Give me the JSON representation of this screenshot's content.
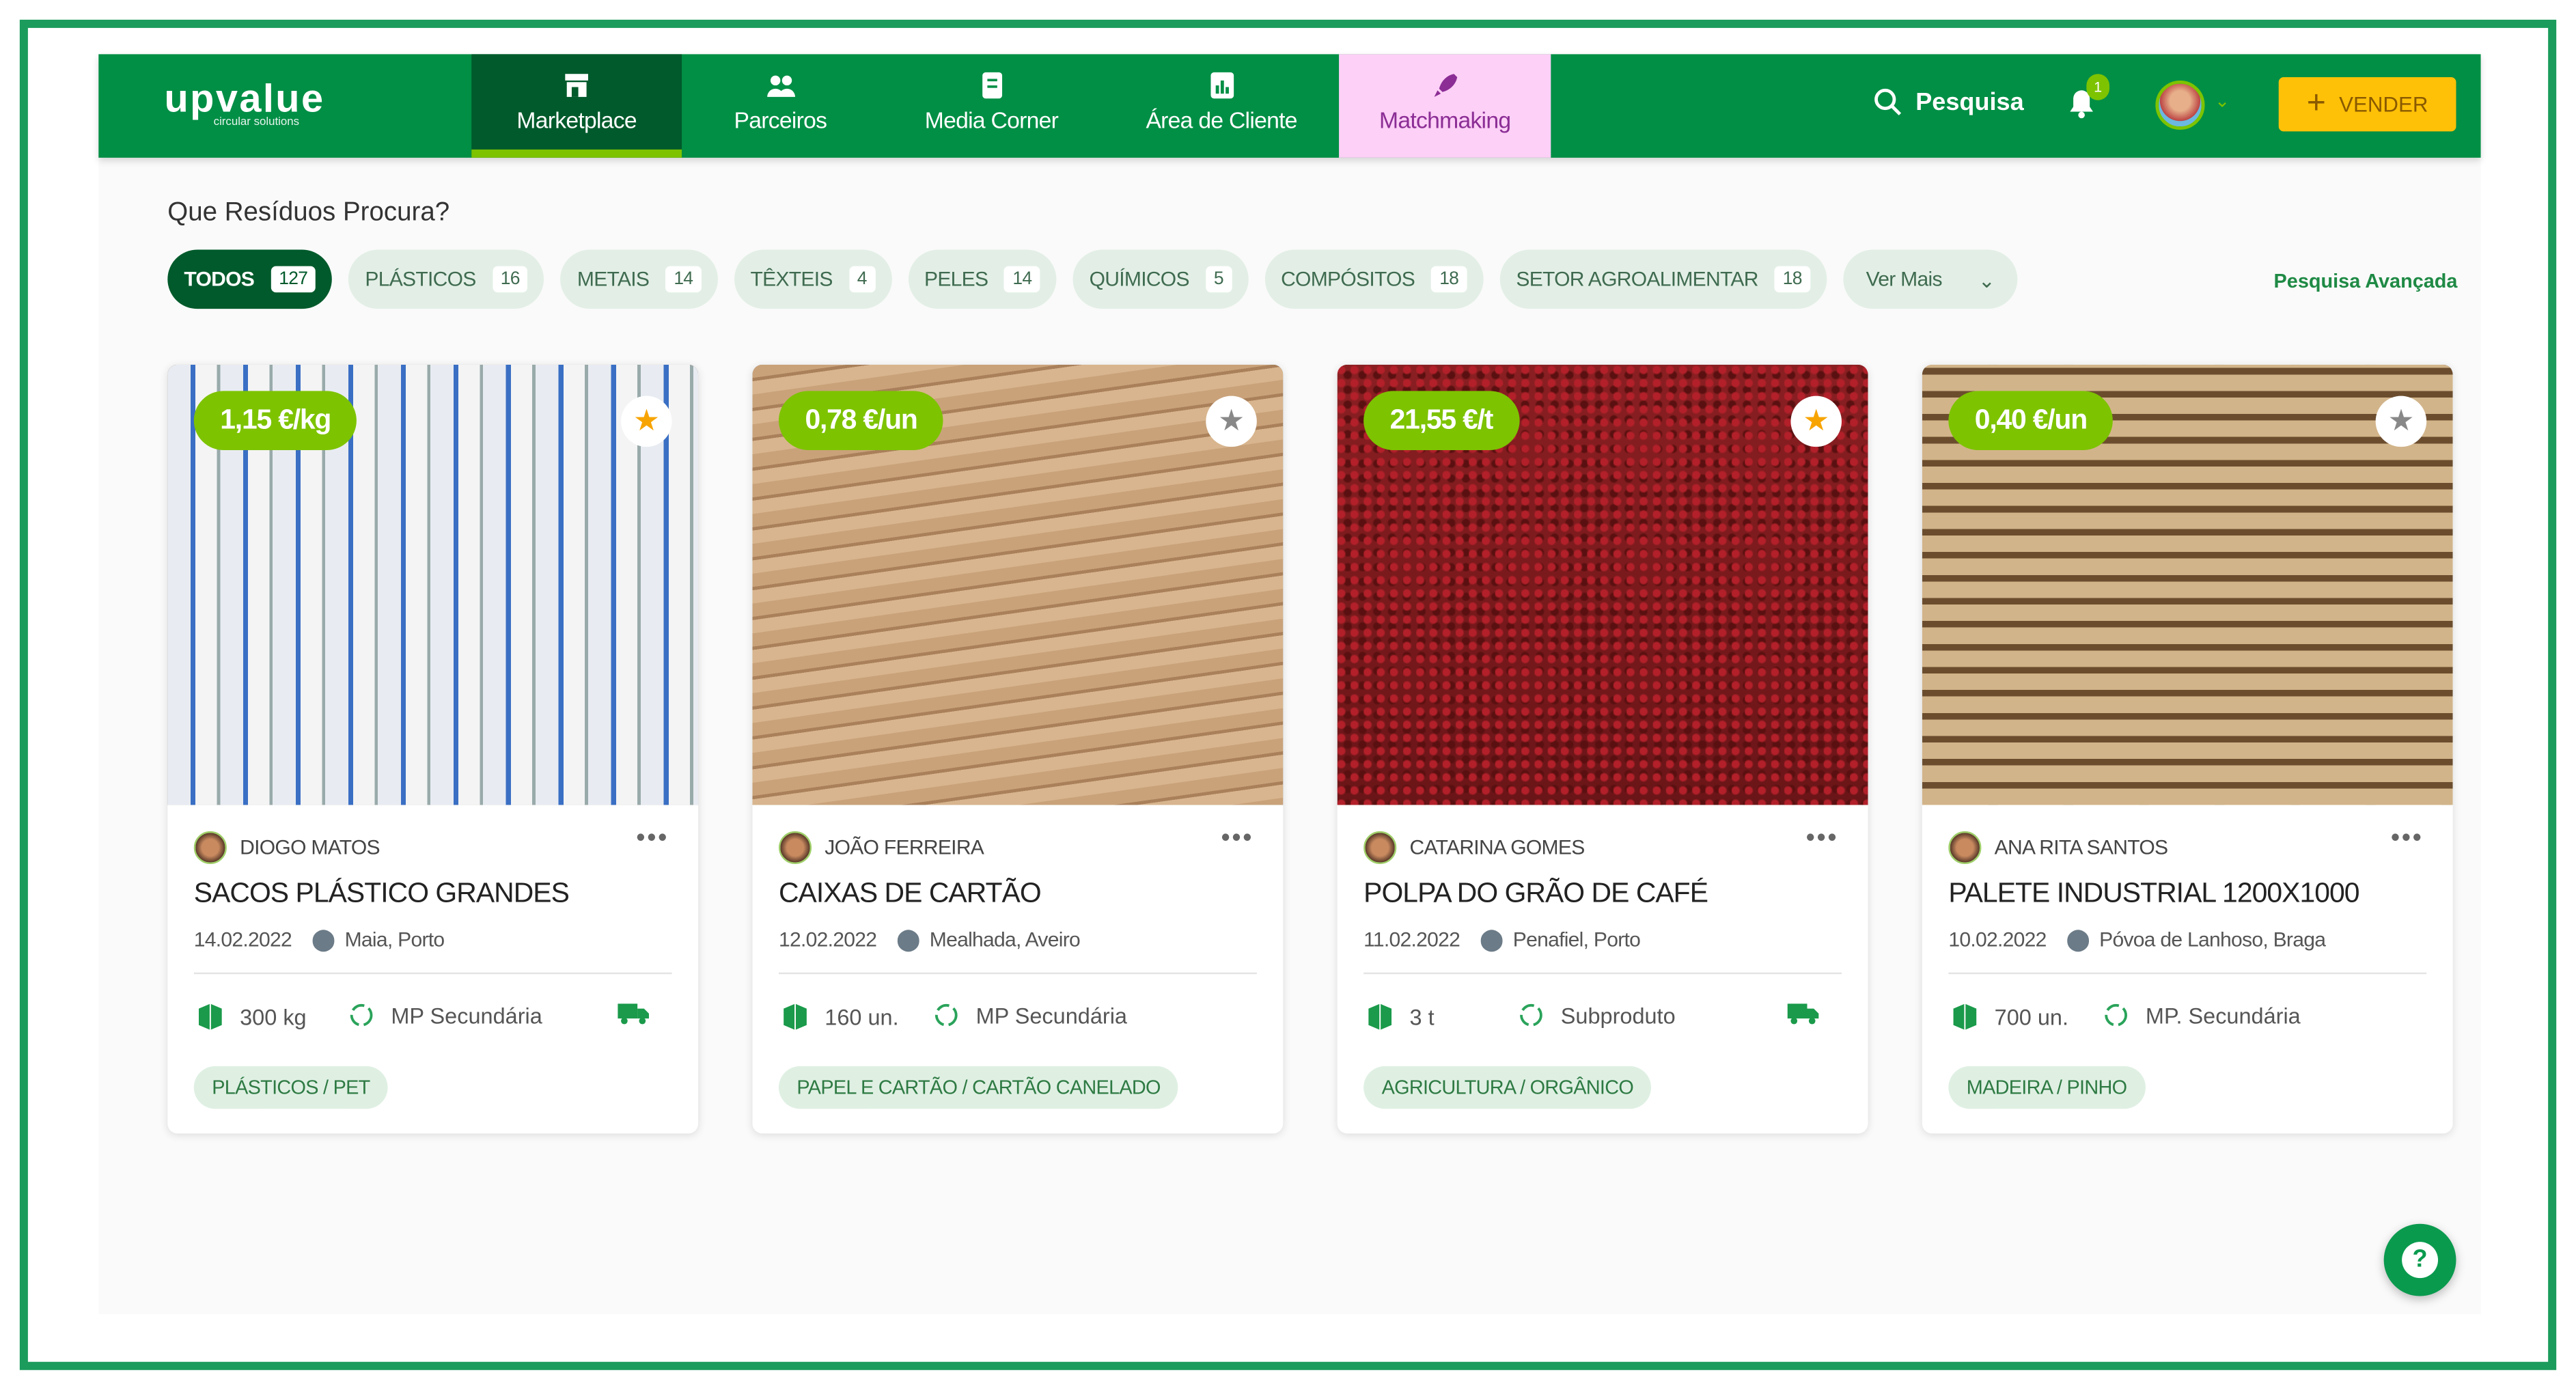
{
  "brand": {
    "name": "upvalue",
    "tagline": "circular solutions"
  },
  "nav": {
    "tabs": [
      {
        "label": "Marketplace"
      },
      {
        "label": "Parceiros"
      },
      {
        "label": "Media Corner"
      },
      {
        "label": "Área de Cliente"
      },
      {
        "label": "Matchmaking"
      }
    ],
    "search_label": "Pesquisa",
    "notifications": "1",
    "sell_label": "VENDER",
    "sell_icon": "+"
  },
  "filters": {
    "heading": "Que Resíduos Procura?",
    "chips": [
      {
        "label": "TODOS",
        "count": "127"
      },
      {
        "label": "PLÁSTICOS",
        "count": "16"
      },
      {
        "label": "METAIS",
        "count": "14"
      },
      {
        "label": "TÊXTEIS",
        "count": "4"
      },
      {
        "label": "PELES",
        "count": "14"
      },
      {
        "label": "QUÍMICOS",
        "count": "5"
      },
      {
        "label": "COMPÓSITOS",
        "count": "18"
      },
      {
        "label": "SETOR AGROALIMENTAR",
        "count": "18"
      }
    ],
    "more_label": "Ver Mais",
    "advanced_label": "Pesquisa Avançada"
  },
  "cards": [
    {
      "price": "1,15 €/kg",
      "favorite": true,
      "user": "DIOGO MATOS",
      "title": "SACOS PLÁSTICO GRANDES",
      "date": "14.02.2022",
      "location": "Maia, Porto",
      "quantity": "300 kg",
      "type": "MP Secundária",
      "transport": true,
      "tag": "PLÁSTICOS / PET"
    },
    {
      "price": "0,78 €/un",
      "favorite": false,
      "user": "JOÃO FERREIRA",
      "title": "CAIXAS DE CARTÃO",
      "date": "12.02.2022",
      "location": "Mealhada, Aveiro",
      "quantity": "160 un.",
      "type": "MP Secundária",
      "transport": false,
      "tag": "PAPEL E CARTÃO / CARTÃO CANELADO"
    },
    {
      "price": "21,55 €/t",
      "favorite": true,
      "user": "CATARINA GOMES",
      "title": "POLPA DO GRÃO DE CAFÉ",
      "date": "11.02.2022",
      "location": "Penafiel, Porto",
      "quantity": "3 t",
      "type": "Subproduto",
      "transport": true,
      "tag": "AGRICULTURA / ORGÂNICO"
    },
    {
      "price": "0,40 €/un",
      "favorite": false,
      "user": "ANA RITA SANTOS",
      "title": "PALETE INDUSTRIAL 1200X1000",
      "date": "10.02.2022",
      "location": "Póvoa de Lanhoso, Braga",
      "quantity": "700 un.",
      "type": "MP. Secundária",
      "transport": false,
      "tag": "MADEIRA / PINHO"
    }
  ],
  "help_label": "?",
  "colors": {
    "primary": "#008f45",
    "dark": "#005a2b",
    "accent": "#7dc300",
    "sell": "#ffc107",
    "matchmaking_bg": "#fdd0f7"
  }
}
